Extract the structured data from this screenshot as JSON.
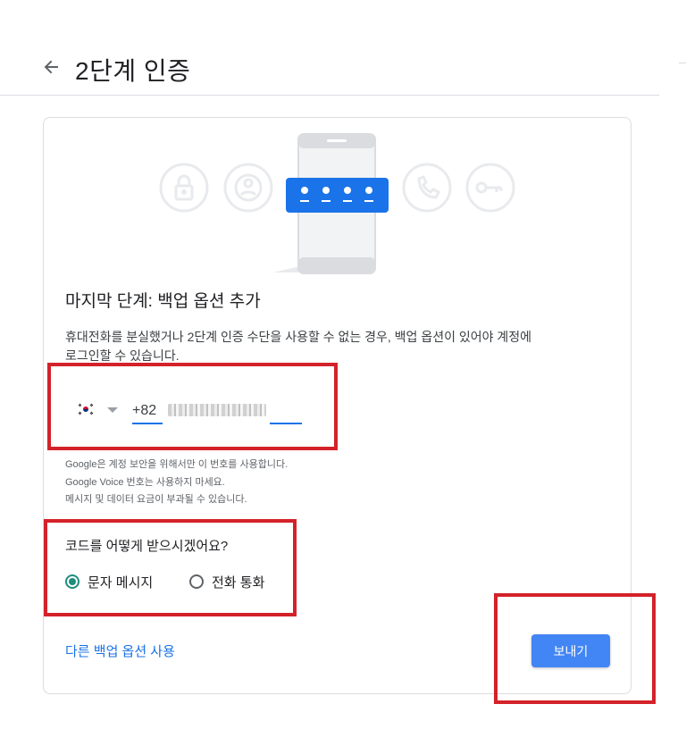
{
  "header": {
    "title": "2단계 인증",
    "back_icon": "arrow-left-icon"
  },
  "illustration": {
    "icons": [
      "lock-icon",
      "account-circle-icon",
      "phone-call-icon",
      "key-icon"
    ],
    "code_dots": 4
  },
  "main": {
    "section_title": "마지막 단계: 백업 옵션 추가",
    "description_line1": "휴대전화를 분실했거나 2단계 인증 수단을 사용할 수 없는 경우, 백업 옵션이 있어야 계정에",
    "description_line2": "로그인할 수 있습니다.",
    "phone": {
      "country_flag": "south-korea-flag-icon",
      "country_code": "+82",
      "number": "blurred"
    },
    "notice_lines": [
      "Google은 계정 보안을 위해서만 이 번호를 사용합니다.",
      "Google Voice 번호는 사용하지 마세요.",
      "메시지 및 데이터 요금이 부과될 수 있습니다."
    ],
    "question": "코드를 어떻게 받으시겠어요?",
    "options": [
      {
        "label": "문자 메시지",
        "checked": true
      },
      {
        "label": "전화 통화",
        "checked": false
      }
    ],
    "alt_link": "다른 백업 옵션 사용",
    "send_label": "보내기"
  },
  "colors": {
    "accent": "#1a73e8",
    "button": "#4285f4",
    "radio_checked": "#1e8e7e",
    "highlight": "#d3222a"
  }
}
